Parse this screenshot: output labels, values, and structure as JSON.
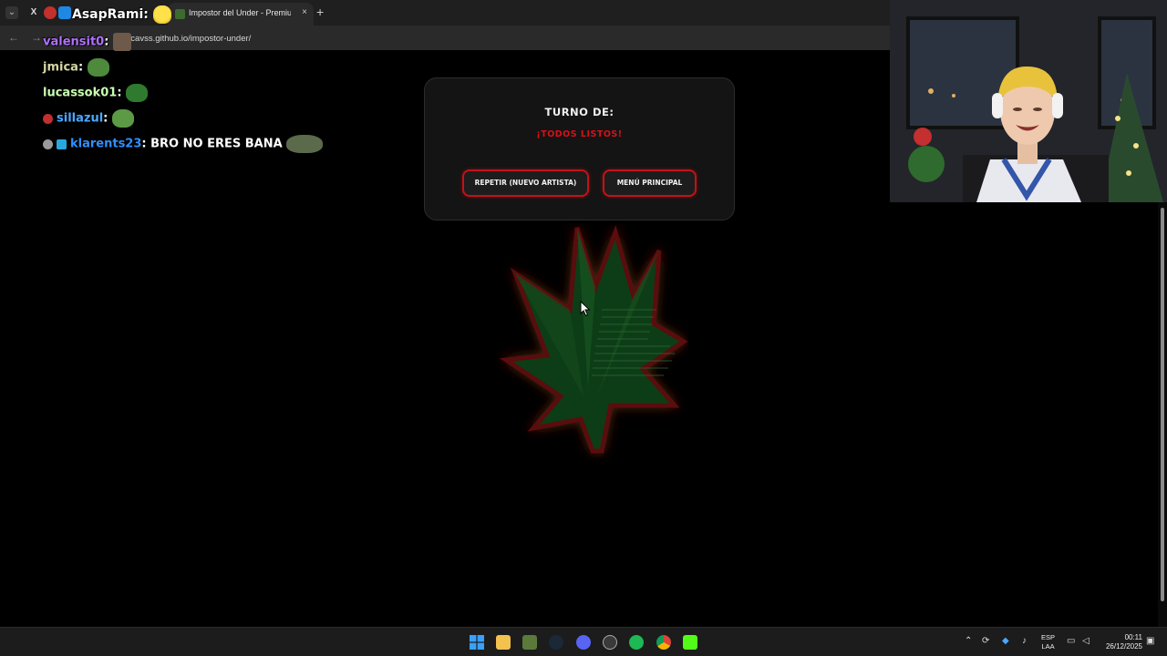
{
  "browser": {
    "active_tab_title": "Impostor del Under - Premium",
    "tab_close": "×",
    "new_tab": "+",
    "url": "ocavss.github.io/impostor-under/",
    "nav_back": "←",
    "nav_forward": "→"
  },
  "chat": [
    {
      "user": "AsapRami",
      "color": "#ffffff",
      "message": ""
    },
    {
      "user": "valensit0",
      "color": "#b070ff",
      "message": ""
    },
    {
      "user": "jmica",
      "color": "#d6d6a6",
      "message": ""
    },
    {
      "user": "lucassok01",
      "color": "#c8ffb0",
      "message": ""
    },
    {
      "user": "sillazul",
      "color": "#4aa8ff",
      "message": ""
    },
    {
      "user": "klarents23",
      "color": "#2f8fff",
      "message": "BRO NO ERES BANA"
    }
  ],
  "game": {
    "turn_label": "TURNO DE:",
    "turn_status": "¡TODOS LISTOS!",
    "repeat_button": "REPETIR (NUEVO ARTISTA)",
    "menu_button": "MENÚ PRINCIPAL",
    "accent_color": "#c2121a"
  },
  "taskbar": {
    "language_top": "ESP",
    "language_bottom": "LAA",
    "time": "00:11",
    "date": "26/12/2025"
  }
}
